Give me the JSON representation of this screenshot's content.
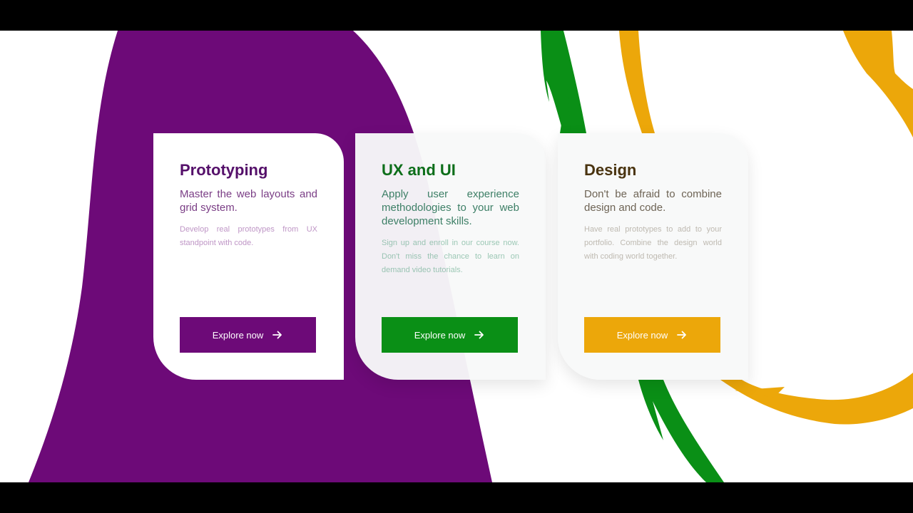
{
  "colors": {
    "purple": "#6d0a78",
    "purple_title": "#55106a",
    "green": "#0a8f16",
    "green_title": "#0d6e1a",
    "orange": "#eca70a",
    "brown_title": "#4a3410"
  },
  "cards": [
    {
      "title": "Prototyping",
      "lead": "Master the web layouts and grid system.",
      "note": "Develop real prototypes from UX standpoint with code.",
      "button_label": "Explore now",
      "button_icon": "arrow-right-icon"
    },
    {
      "title": "UX and UI",
      "lead": "Apply user experience methodologies to your web development skills.",
      "note": "Sign up and enroll in our course now. Don't miss the chance to learn on demand video tutorials.",
      "button_label": "Explore now",
      "button_icon": "arrow-right-icon"
    },
    {
      "title": "Design",
      "lead": "Don't be afraid to combine design and code.",
      "note": "Have real prototypes to add to your portfolio. Combine the design world with coding world together.",
      "button_label": "Explore now",
      "button_icon": "arrow-right-icon"
    }
  ]
}
